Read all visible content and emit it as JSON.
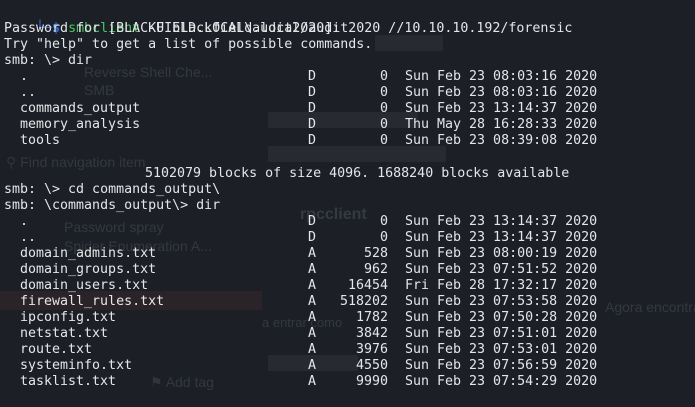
{
  "background_page": {
    "items": [
      {
        "text": "Reverse Shell Che...",
        "kind": "link"
      },
      {
        "text": "SMB",
        "kind": "link"
      },
      {
        "text": "Find navigation item",
        "kind": "search"
      },
      {
        "text": "Password spray",
        "kind": "link"
      },
      {
        "text": "Spider Enumeration A...",
        "kind": "link"
      },
      {
        "text": "Add tag",
        "kind": "button"
      },
      {
        "text": "rpcclient",
        "kind": "heading"
      },
      {
        "text": "Agora encontramo",
        "kind": "text"
      },
      {
        "text": "a entrar como",
        "kind": "text"
      }
    ]
  },
  "terminal": {
    "prompt_corner": "└─",
    "prompt_symbol": "$",
    "lines": [
      {
        "keyword": "smbclient",
        "rest": " -U blackfield.local/audit2020 //10.10.10.192/forensic"
      },
      {
        "text": "Password for [BLACKFIELD.LOCAL\\audit2020]:"
      },
      {
        "text": "Try \"help\" to get a list of possible commands."
      },
      {
        "text": "smb: \\> dir"
      }
    ],
    "listing1": [
      {
        "name": ".",
        "attr": "D",
        "size": "0",
        "date": "Sun Feb 23 08:03:16 2020"
      },
      {
        "name": "..",
        "attr": "D",
        "size": "0",
        "date": "Sun Feb 23 08:03:16 2020"
      },
      {
        "name": "commands_output",
        "attr": "D",
        "size": "0",
        "date": "Sun Feb 23 13:14:37 2020"
      },
      {
        "name": "memory_analysis",
        "attr": "D",
        "size": "0",
        "date": "Thu May 28 16:28:33 2020"
      },
      {
        "name": "tools",
        "attr": "D",
        "size": "0",
        "date": "Sun Feb 23 08:39:08 2020"
      }
    ],
    "blocks_line": "5102079 blocks of size 4096. 1688240 blocks available",
    "cmd_cd": "smb: \\> cd commands_output\\",
    "cmd_dir2": "smb: \\commands_output\\> dir",
    "listing2": [
      {
        "name": ".",
        "attr": "D",
        "size": "0",
        "date": "Sun Feb 23 13:14:37 2020"
      },
      {
        "name": "..",
        "attr": "D",
        "size": "0",
        "date": "Sun Feb 23 13:14:37 2020"
      },
      {
        "name": "domain_admins.txt",
        "attr": "A",
        "size": "528",
        "date": "Sun Feb 23 08:00:19 2020"
      },
      {
        "name": "domain_groups.txt",
        "attr": "A",
        "size": "962",
        "date": "Sun Feb 23 07:51:52 2020"
      },
      {
        "name": "domain_users.txt",
        "attr": "A",
        "size": "16454",
        "date": "Fri Feb 28 17:32:17 2020"
      },
      {
        "name": "firewall_rules.txt",
        "attr": "A",
        "size": "518202",
        "date": "Sun Feb 23 07:53:58 2020"
      },
      {
        "name": "ipconfig.txt",
        "attr": "A",
        "size": "1782",
        "date": "Sun Feb 23 07:50:28 2020"
      },
      {
        "name": "netstat.txt",
        "attr": "A",
        "size": "3842",
        "date": "Sun Feb 23 07:51:01 2020"
      },
      {
        "name": "route.txt",
        "attr": "A",
        "size": "3976",
        "date": "Sun Feb 23 07:53:01 2020"
      },
      {
        "name": "systeminfo.txt",
        "attr": "A",
        "size": "4550",
        "date": "Sun Feb 23 07:56:59 2020"
      },
      {
        "name": "tasklist.txt",
        "attr": "A",
        "size": "9990",
        "date": "Sun Feb 23 07:54:29 2020"
      }
    ]
  },
  "colors": {
    "prompt_blue": "#2f6fd6",
    "keyword_green": "#47c95f",
    "text": "#e4e6e8",
    "background": "#1f232b"
  }
}
